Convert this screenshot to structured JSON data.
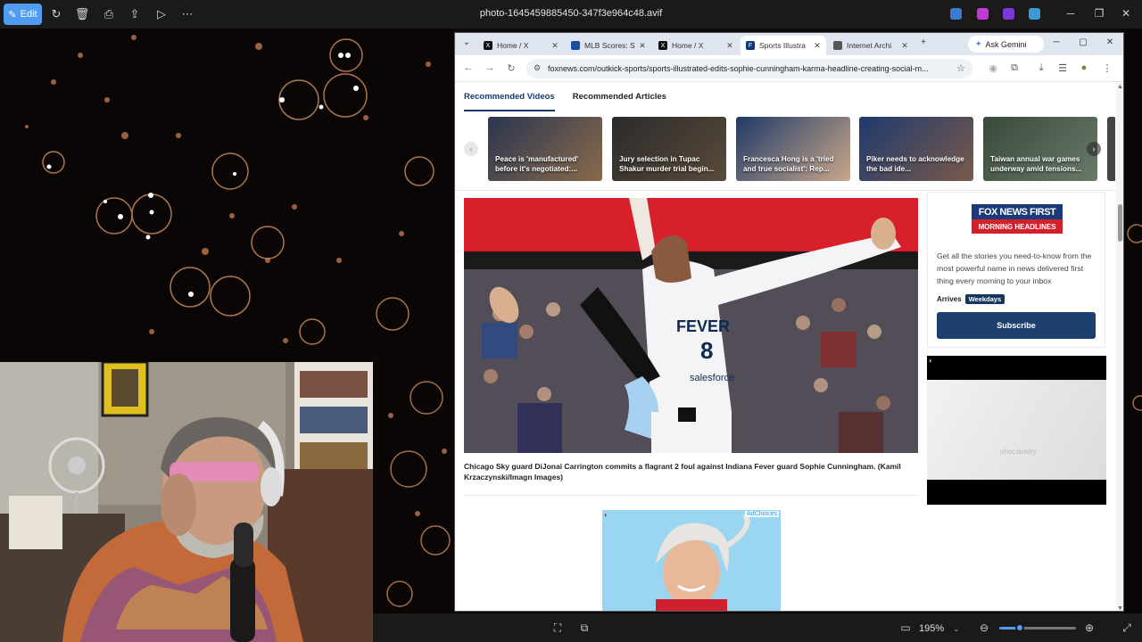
{
  "viewer": {
    "edit_label": "Edit",
    "title": "photo-1645459885450-347f3e964c48.avif",
    "zoom": "195%",
    "zoom_level": 0.27
  },
  "browser": {
    "tabs": [
      {
        "label": "Home / X",
        "fav": "X",
        "fav_color": "#111111"
      },
      {
        "label": "MLB Scores: S",
        "fav": "",
        "fav_color": "#1a4fa0"
      },
      {
        "label": "Home / X",
        "fav": "X",
        "fav_color": "#111111"
      },
      {
        "label": "Sports Illustra",
        "fav": "F",
        "fav_color": "#0c3a78",
        "active": true
      },
      {
        "label": "Internet Archi",
        "fav": "",
        "fav_color": "#555555"
      }
    ],
    "new_tab": "+",
    "gemini_label": "Ask Gemini",
    "url": "foxnews.com/outkick-sports/sports-illustrated-edits-sophie-cunningham-karma-headline-creating-social-m..."
  },
  "page": {
    "recommended_tabs": [
      "Recommended Videos",
      "Recommended Articles"
    ],
    "videos": [
      {
        "title": "Peace is 'manufactured' before it's negotiated:...",
        "color1": "#2a3650",
        "color2": "#8a6a4a"
      },
      {
        "title": "Jury selection in Tupac Shakur murder trial begin...",
        "color1": "#2b2b2b",
        "color2": "#5a4a3a"
      },
      {
        "title": "Francesca Hong is a 'tried and true socialist': Rep...",
        "color1": "#203a68",
        "color2": "#c9a78a"
      },
      {
        "title": "Piker needs to acknowledge the bad ide...",
        "color1": "#1e3a6e",
        "color2": "#7a5a4a"
      },
      {
        "title": "Taiwan annual war games underway amid tensions...",
        "color1": "#3a4a3a",
        "color2": "#6a7a6a"
      }
    ],
    "hero": {
      "jersey_team": "FEVER",
      "jersey_number": "8",
      "jersey_sponsor": "salesforce"
    },
    "caption": "Chicago Sky guard DiJonai Carrington commits a flagrant 2 foul against Indiana Fever guard Sophie Cunningham. (Kamil Krzaczynski/Imagn Images)",
    "newsletter": {
      "logo_line1": "FOX NEWS FIRST",
      "logo_line2": "MORNING HEADLINES",
      "description": "Get all the stories you need-to-know from the most powerful name in news delivered first thing every morning to your inbox",
      "arrives_label": "Arrives",
      "arrives_badge": "Weekdays",
      "subscribe_label": "Subscribe"
    },
    "video_ad_watermark": "ohocolustry",
    "adchoices": "AdChoices"
  },
  "colors": {
    "accent": "#4f9cf0",
    "fox_navy": "#1d3f6e"
  }
}
